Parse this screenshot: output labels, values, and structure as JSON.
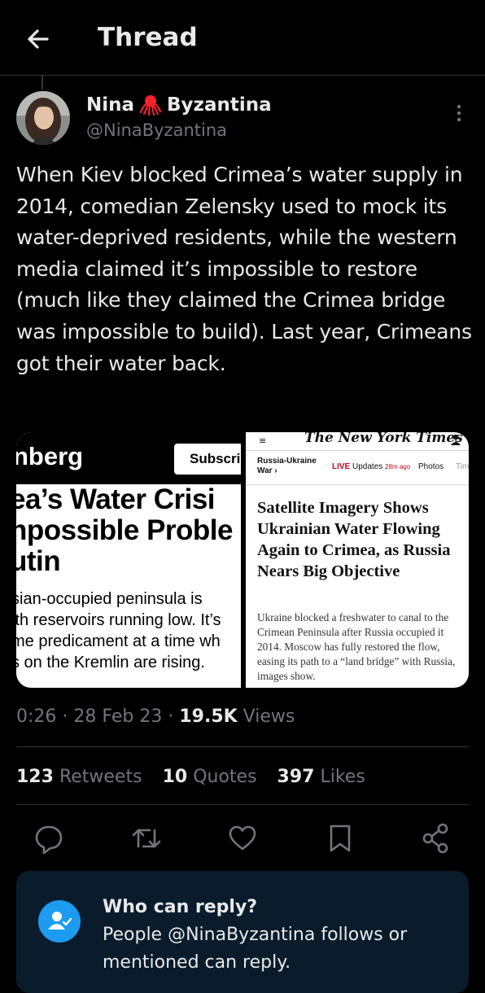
{
  "header": {
    "title": "Thread"
  },
  "author": {
    "first_name": "Nina",
    "last_name": "Byzantina",
    "handle": "@NinaByzantina"
  },
  "tweet": {
    "text": "When Kiev blocked Crimea’s water supply in 2014, comedian Zelensky used to mock its water-deprived residents, while the western media claimed it’s impossible to restore (much like they claimed the Crimea bridge was impossible to build). Last year, Crimeans got their water back.",
    "time": "0:26",
    "date": "28 Feb 23",
    "views_count": "19.5K",
    "views_label": "Views",
    "sep": "·"
  },
  "media": {
    "left": {
      "logo": "nberg",
      "subscribe": "Subscri",
      "headline": "ea’s Water Crisi\nnpossible Proble\nutin",
      "subhead": "sian-occupied peninsula is\nith reservoirs running low. It’s\nme predicament at a time wh\ns on the Kremlin are rising."
    },
    "right": {
      "menu": "≡",
      "masthead": "The New York Times",
      "section": "Russia-Ukraine War ›",
      "live": "LIVE",
      "updates": "Updates",
      "ago": "28m ago",
      "photos": "Photos",
      "tim": "Tim",
      "headline": "Satellite Imagery Shows Ukrainian Water Flowing Again to Crimea, as Russia Nears Big Objective",
      "summary": "Ukraine blocked a freshwater to canal to the Crimean Peninsula after Russia occupied it 2014. Moscow has fully restored the flow, easing its path to a “land bridge” with Russia, images show."
    }
  },
  "stats": {
    "retweets_count": "123",
    "retweets_label": "Retweets",
    "quotes_count": "10",
    "quotes_label": "Quotes",
    "likes_count": "397",
    "likes_label": "Likes"
  },
  "reply_card": {
    "title": "Who can reply?",
    "text": "People @NinaByzantina follows or mentioned can reply."
  },
  "colors": {
    "accent": "#1d9bf0",
    "octopus": "#f4212e",
    "muted": "#71767b"
  }
}
